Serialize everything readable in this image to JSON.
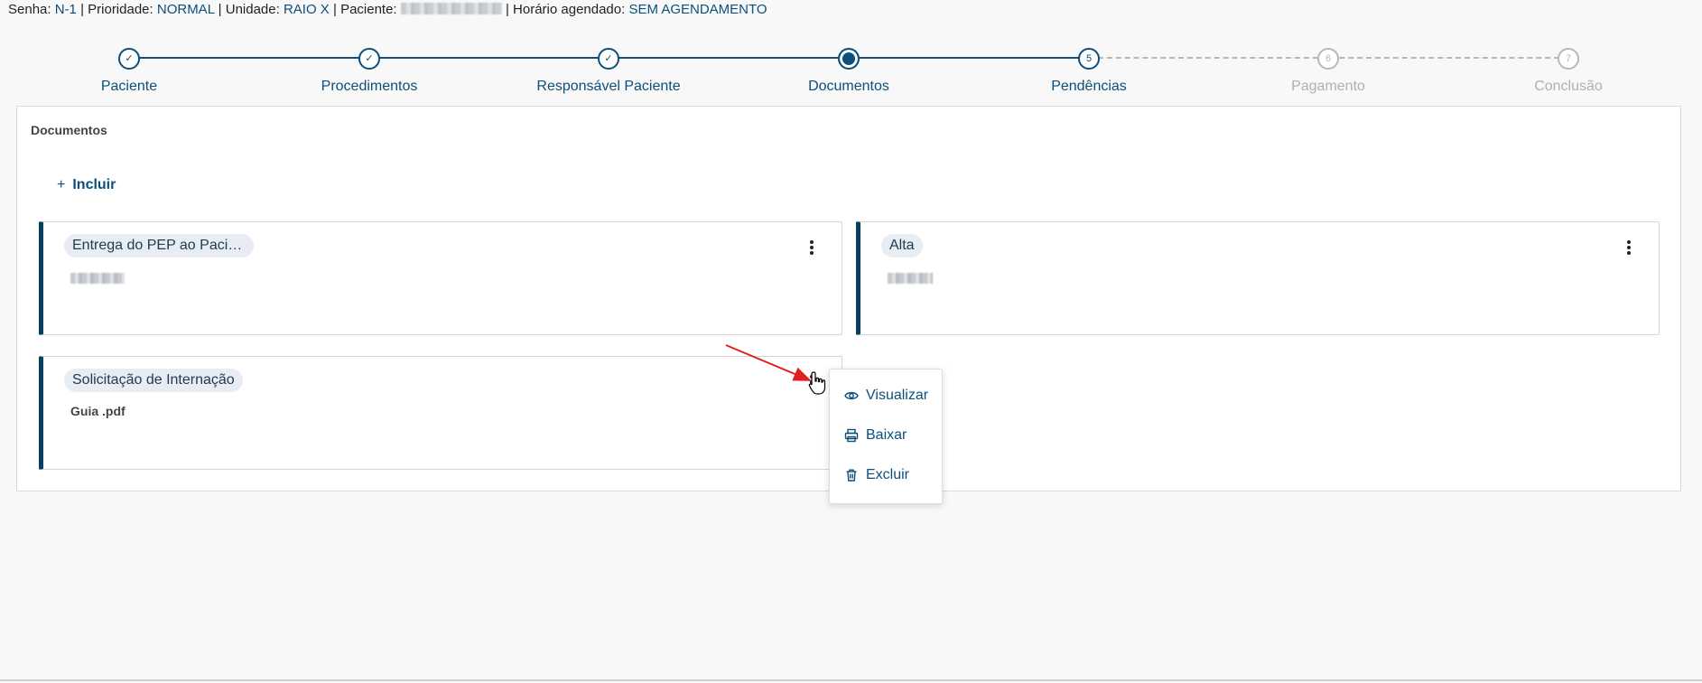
{
  "header": {
    "senha_label": "Senha:",
    "senha_value": "N-1",
    "prioridade_label": "Prioridade:",
    "prioridade_value": "NORMAL",
    "unidade_label": "Unidade:",
    "unidade_value": "RAIO X",
    "paciente_label": "Paciente:",
    "horario_label": "Horário agendado:",
    "horario_value": "SEM AGENDAMENTO",
    "separator": "|"
  },
  "stepper": {
    "steps": [
      {
        "label": "Paciente",
        "state": "done",
        "marker": "✓"
      },
      {
        "label": "Procedimentos",
        "state": "done",
        "marker": "✓"
      },
      {
        "label": "Responsável Paciente",
        "state": "done",
        "marker": "✓"
      },
      {
        "label": "Documentos",
        "state": "current",
        "marker": ""
      },
      {
        "label": "Pendências",
        "state": "active",
        "marker": "5"
      },
      {
        "label": "Pagamento",
        "state": "todo",
        "marker": "6"
      },
      {
        "label": "Conclusão",
        "state": "todo",
        "marker": "7"
      }
    ]
  },
  "panel": {
    "title": "Documentos",
    "add_icon": "+",
    "add_label": "Incluir"
  },
  "cards": [
    {
      "tag": "Entrega do PEP ao Pacien...",
      "file": ""
    },
    {
      "tag": "Alta",
      "file": ""
    },
    {
      "tag": "Solicitação de Internação",
      "file": "Guia .pdf"
    }
  ],
  "menu": {
    "items": [
      {
        "label": "Visualizar",
        "icon": "eye-icon"
      },
      {
        "label": "Baixar",
        "icon": "printer-icon"
      },
      {
        "label": "Excluir",
        "icon": "trash-icon"
      }
    ]
  },
  "colors": {
    "primary": "#0b4f7a",
    "card_border": "#0b3d5e",
    "inactive": "#b0b0b0",
    "annotation_arrow": "#e02020"
  }
}
